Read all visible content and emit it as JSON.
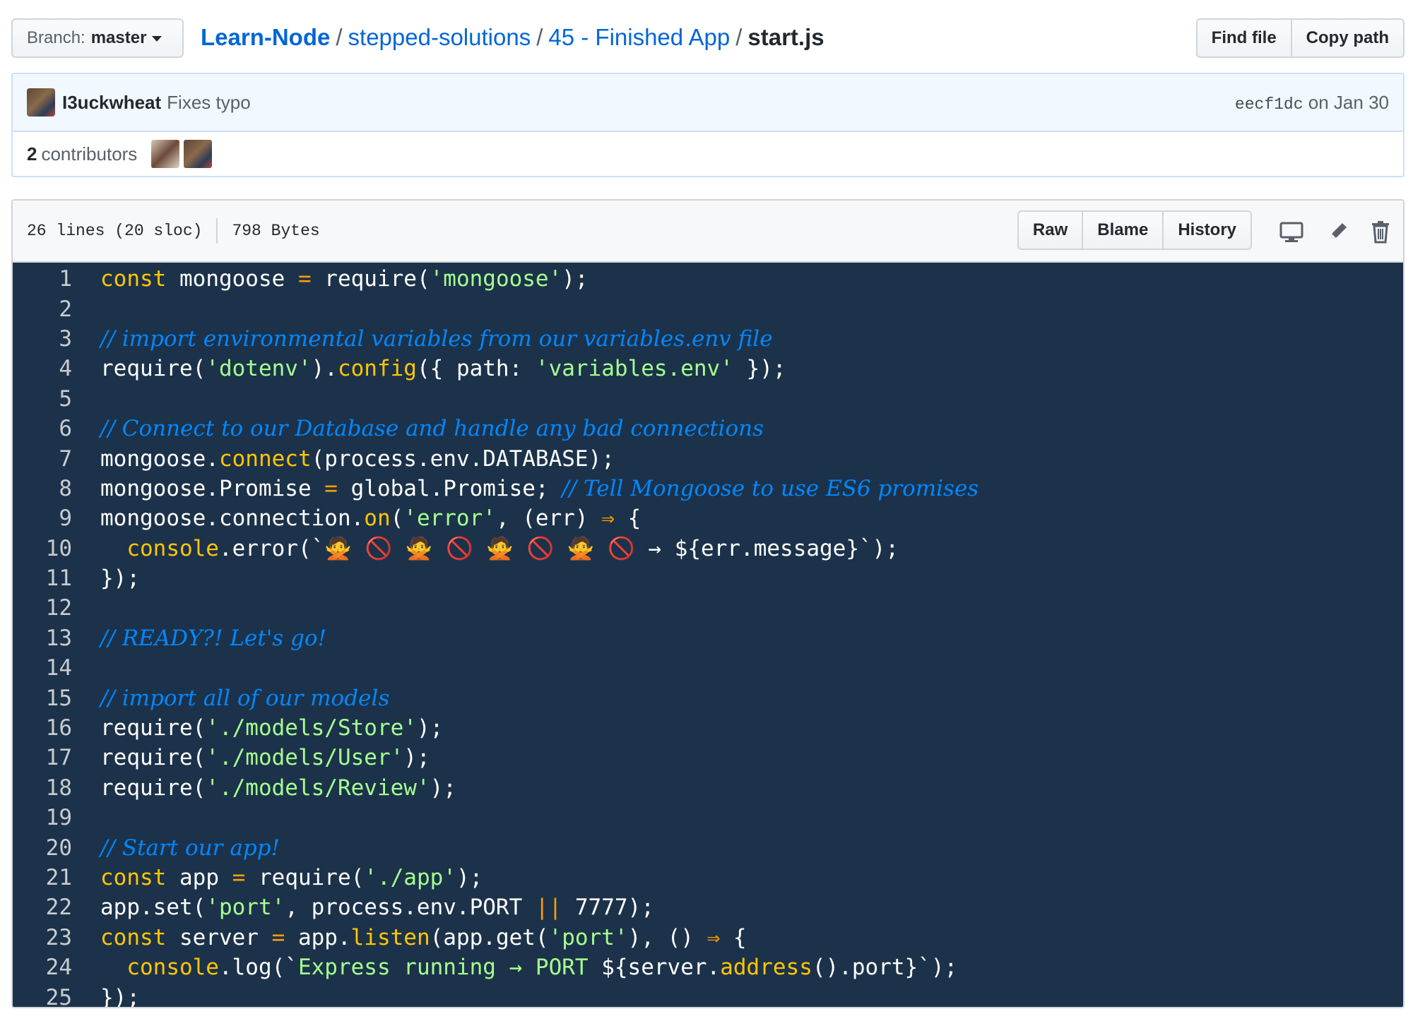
{
  "top": {
    "branch_prefix": "Branch:",
    "branch_name": "master",
    "breadcrumb": {
      "repo": "Learn-Node",
      "dir1": "stepped-solutions",
      "dir2": "45 - Finished App",
      "file": "start.js",
      "separator": "/"
    },
    "find_file": "Find file",
    "copy_path": "Copy path"
  },
  "commit": {
    "author": "I3uckwheat",
    "message": "Fixes typo",
    "sha": "eecf1dc",
    "date": "on Jan 30",
    "contributors_count": "2",
    "contributors_label": "contributors"
  },
  "file": {
    "lines_info": "26 lines (20 sloc)",
    "size": "798 Bytes",
    "raw": "Raw",
    "blame": "Blame",
    "history": "History"
  },
  "icons": [
    "desktop-icon",
    "pencil-icon",
    "trash-icon",
    "chevron-down-icon"
  ],
  "colors": {
    "code_bg": "#1c324a",
    "keyword": "#ffc600",
    "string": "#a5ff90",
    "comment": "#0088ff",
    "link": "#0366d6"
  },
  "code": {
    "l1": [
      "const",
      " mongoose ",
      "=",
      " require(",
      "'mongoose'",
      ");"
    ],
    "l3": "// import environmental variables from our variables.env file",
    "l4": [
      "require(",
      "'dotenv'",
      ").",
      "config",
      "({ ",
      "path",
      ": ",
      "'variables.env'",
      " });"
    ],
    "l6": "// Connect to our Database and handle any bad connections",
    "l7": [
      "mongoose.",
      "connect",
      "(process.env.DATABASE);"
    ],
    "l8": [
      "mongoose.Promise ",
      "=",
      " global.Promise; ",
      "// Tell Mongoose to use ES6 promises"
    ],
    "l9": [
      "mongoose.connection.",
      "on",
      "(",
      "'error'",
      ", (err) ",
      "⇒",
      " {"
    ],
    "l10": [
      "  ",
      "console",
      ".error(`",
      "🙅 🚫 🙅 🚫 🙅 🚫 🙅 🚫 → ${err.message}`);"
    ],
    "l11": "});",
    "l13": "// READY?! Let's go!",
    "l15": "// import all of our models",
    "l16": [
      "require(",
      "'./models/Store'",
      ");"
    ],
    "l17": [
      "require(",
      "'./models/User'",
      ");"
    ],
    "l18": [
      "require(",
      "'./models/Review'",
      ");"
    ],
    "l20": "// Start our app!",
    "l21": [
      "const",
      " app ",
      "=",
      " require(",
      "'./app'",
      ");"
    ],
    "l22": [
      "app.set(",
      "'port'",
      ", process.env.PORT ",
      "||",
      " 7777);"
    ],
    "l23": [
      "const",
      " server ",
      "=",
      " app.",
      "listen",
      "(app.get(",
      "'port'",
      "), () ",
      "⇒",
      " {"
    ],
    "l24": [
      "  ",
      "console",
      ".log(`",
      "Express running → PORT ",
      "${server.",
      "address",
      "().port}`);"
    ],
    "l25": "});"
  }
}
